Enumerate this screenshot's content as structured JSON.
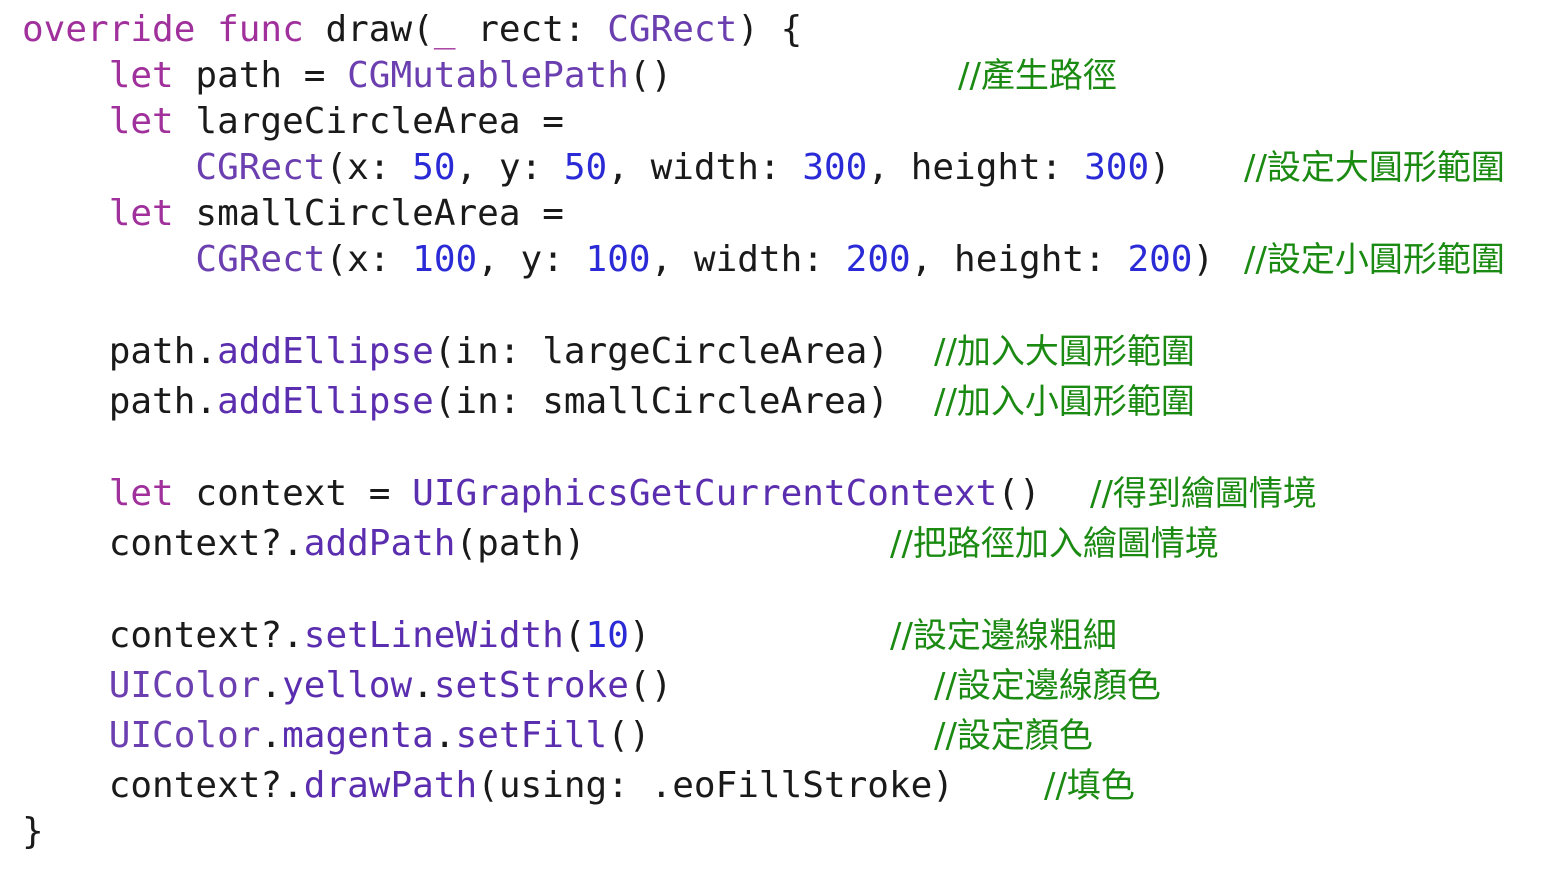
{
  "editor": {
    "language": "swift",
    "colors": {
      "background": "#ffffff",
      "keyword": "#a0309b",
      "type": "#6b3fb0",
      "function": "#5b2eb0",
      "number": "#2a2ad6",
      "plain": "#1a1a1a",
      "comment": "#1b8a12"
    },
    "lines": [
      {
        "tokens": [
          {
            "t": "override",
            "c": "kw"
          },
          {
            "t": " ",
            "c": "pl"
          },
          {
            "t": "func",
            "c": "kw"
          },
          {
            "t": " draw(",
            "c": "pl"
          },
          {
            "t": "_",
            "c": "kw"
          },
          {
            "t": " rect: ",
            "c": "pl"
          },
          {
            "t": "CGRect",
            "c": "ty"
          },
          {
            "t": ") {",
            "c": "pl"
          }
        ],
        "comment": ""
      },
      {
        "tokens": [
          {
            "t": "    ",
            "c": "pl"
          },
          {
            "t": "let",
            "c": "kw"
          },
          {
            "t": " path = ",
            "c": "pl"
          },
          {
            "t": "CGMutablePath",
            "c": "ty"
          },
          {
            "t": "()",
            "c": "pl"
          }
        ],
        "comment": "//產生路徑"
      },
      {
        "tokens": [
          {
            "t": "    ",
            "c": "pl"
          },
          {
            "t": "let",
            "c": "kw"
          },
          {
            "t": " largeCircleArea =",
            "c": "pl"
          }
        ],
        "comment": ""
      },
      {
        "tokens": [
          {
            "t": "        ",
            "c": "pl"
          },
          {
            "t": "CGRect",
            "c": "ty"
          },
          {
            "t": "(x: ",
            "c": "pl"
          },
          {
            "t": "50",
            "c": "num"
          },
          {
            "t": ", y: ",
            "c": "pl"
          },
          {
            "t": "50",
            "c": "num"
          },
          {
            "t": ", width: ",
            "c": "pl"
          },
          {
            "t": "300",
            "c": "num"
          },
          {
            "t": ", height: ",
            "c": "pl"
          },
          {
            "t": "300",
            "c": "num"
          },
          {
            "t": ")",
            "c": "pl"
          }
        ],
        "comment": "//設定大圓形範圍"
      },
      {
        "tokens": [
          {
            "t": "    ",
            "c": "pl"
          },
          {
            "t": "let",
            "c": "kw"
          },
          {
            "t": " smallCircleArea =",
            "c": "pl"
          }
        ],
        "comment": ""
      },
      {
        "tokens": [
          {
            "t": "        ",
            "c": "pl"
          },
          {
            "t": "CGRect",
            "c": "ty"
          },
          {
            "t": "(x: ",
            "c": "pl"
          },
          {
            "t": "100",
            "c": "num"
          },
          {
            "t": ", y: ",
            "c": "pl"
          },
          {
            "t": "100",
            "c": "num"
          },
          {
            "t": ", width: ",
            "c": "pl"
          },
          {
            "t": "200",
            "c": "num"
          },
          {
            "t": ", height: ",
            "c": "pl"
          },
          {
            "t": "200",
            "c": "num"
          },
          {
            "t": ")",
            "c": "pl"
          }
        ],
        "comment": "//設定小圓形範圍"
      },
      {
        "tokens": [
          {
            "t": "    path.",
            "c": "pl"
          },
          {
            "t": "addEllipse",
            "c": "fn"
          },
          {
            "t": "(in: largeCircleArea)",
            "c": "pl"
          }
        ],
        "comment": "//加入大圓形範圍"
      },
      {
        "tokens": [
          {
            "t": "    path.",
            "c": "pl"
          },
          {
            "t": "addEllipse",
            "c": "fn"
          },
          {
            "t": "(in: smallCircleArea)",
            "c": "pl"
          }
        ],
        "comment": "//加入小圓形範圍"
      },
      {
        "tokens": [
          {
            "t": "    ",
            "c": "pl"
          },
          {
            "t": "let",
            "c": "kw"
          },
          {
            "t": " context = ",
            "c": "pl"
          },
          {
            "t": "UIGraphicsGetCurrentContext",
            "c": "fn"
          },
          {
            "t": "()",
            "c": "pl"
          }
        ],
        "comment": "//得到繪圖情境"
      },
      {
        "tokens": [
          {
            "t": "    context?.",
            "c": "pl"
          },
          {
            "t": "addPath",
            "c": "fn"
          },
          {
            "t": "(path)",
            "c": "pl"
          }
        ],
        "comment": "//把路徑加入繪圖情境"
      },
      {
        "tokens": [
          {
            "t": "    context?.",
            "c": "pl"
          },
          {
            "t": "setLineWidth",
            "c": "fn"
          },
          {
            "t": "(",
            "c": "pl"
          },
          {
            "t": "10",
            "c": "num"
          },
          {
            "t": ")",
            "c": "pl"
          }
        ],
        "comment": "//設定邊線粗細"
      },
      {
        "tokens": [
          {
            "t": "    ",
            "c": "pl"
          },
          {
            "t": "UIColor",
            "c": "ty"
          },
          {
            "t": ".",
            "c": "pl"
          },
          {
            "t": "yellow",
            "c": "fn"
          },
          {
            "t": ".",
            "c": "pl"
          },
          {
            "t": "setStroke",
            "c": "fn"
          },
          {
            "t": "()",
            "c": "pl"
          }
        ],
        "comment": "//設定邊線顏色"
      },
      {
        "tokens": [
          {
            "t": "    ",
            "c": "pl"
          },
          {
            "t": "UIColor",
            "c": "ty"
          },
          {
            "t": ".",
            "c": "pl"
          },
          {
            "t": "magenta",
            "c": "fn"
          },
          {
            "t": ".",
            "c": "pl"
          },
          {
            "t": "setFill",
            "c": "fn"
          },
          {
            "t": "()",
            "c": "pl"
          }
        ],
        "comment": "//設定顏色"
      },
      {
        "tokens": [
          {
            "t": "    context?.",
            "c": "pl"
          },
          {
            "t": "drawPath",
            "c": "fn"
          },
          {
            "t": "(using: .eoFillStroke)",
            "c": "pl"
          }
        ],
        "comment": "//填色"
      },
      {
        "tokens": [
          {
            "t": "}",
            "c": "pl"
          }
        ],
        "comment": ""
      }
    ]
  }
}
